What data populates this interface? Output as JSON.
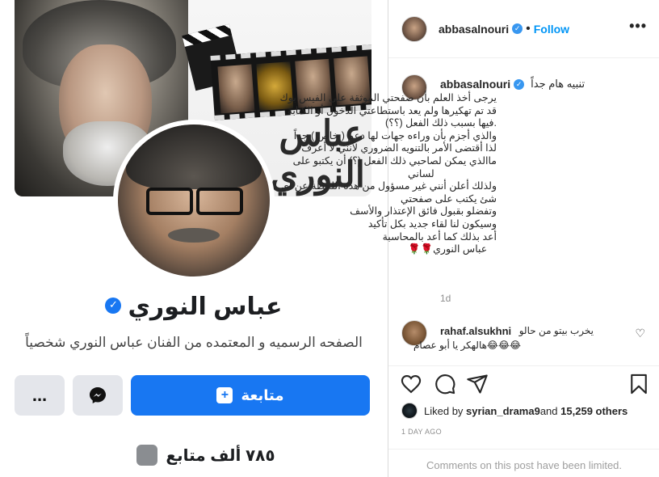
{
  "facebook": {
    "cover_name": "عباس النوري",
    "page_name": "عباس النوري",
    "bio": "الصفحه الرسميه و المعتمده من الفنان عباس النوري شخصياً",
    "more_label": "...",
    "follow_label": "متابعة",
    "followers_count": "٧٨٥ ألف متابع"
  },
  "instagram": {
    "username": "abbasalnouri",
    "follow_label": "Follow",
    "more_label": "•••",
    "caption": {
      "title": "تنبيه هام جداً",
      "lines": [
        "يرجى أخذ العلم بأن صفحتي الموثقة على الفيس بوك",
        "قد تم تهكيرها ولم يعد باستطاعتي الدخول أو الكتابة",
        ".فيها بسبب ذلك الفعل (؟؟)",
        "والذي أجزم بأن وراءه جهات لها دعم ( خاص ) جداً",
        "لذا أقتضى الأمر بالتنويه الضروري لأنني لا أعرف",
        "ماالذي يمكن لصاحبي ذلك الفعل (؟) أن يكتبو على",
        "لساني",
        "ولذلك أعلن أنني غير مسؤول من هذه اللحظة عن أي",
        "شئ يكتب على صفحتي",
        "وتفضلو بقبول فائق الإعتذار والأسف",
        "وسيكون لنا لقاء جديد بكل تأكيد",
        "أعد بذلك كما أعد بالمحاسبة",
        "عباس النوري🌹🌹"
      ],
      "time": "1d"
    },
    "comment": {
      "username": "rahaf.alsukhni",
      "text_line1": "يخرب بيتو من حالو",
      "text_line2": "😂😂😂هالهكر يا أبو عصام"
    },
    "likes": {
      "prefix": "Liked by ",
      "user": "syrian_drama9",
      "middle": " and ",
      "count": "15,259 others"
    },
    "date": "1 DAY AGO",
    "limited": "Comments on this post have been limited."
  }
}
